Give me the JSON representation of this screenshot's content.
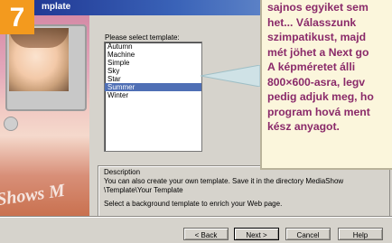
{
  "badge": {
    "number": "7"
  },
  "window": {
    "title": "mplate"
  },
  "preview": {
    "watermark": "Shows M"
  },
  "templates": {
    "label": "Please select template:",
    "items": [
      "Autumn",
      "Machine",
      "Simple",
      "Sky",
      "Star",
      "Summer",
      "Winter"
    ],
    "selected": "Summer"
  },
  "description": {
    "title": "Description",
    "line1": "You can also create your own template. Save it in the directory MediaShow",
    "line2": "\\Template\\Your Template",
    "hint": "Select a background template to enrich your Web page."
  },
  "buttons": {
    "back": "< Back",
    "next": "Next >",
    "cancel": "Cancel",
    "help": "Help"
  },
  "callout": {
    "lines": [
      "sajnos egyiket sem",
      "het... Válasszunk",
      "szimpatikust, majd",
      "mét jöhet a Next go",
      "A képméretet álli",
      "800×600-asra, legv",
      "pedig adjuk meg, ho",
      "program hová ment",
      "kész anyagot."
    ]
  },
  "colors": {
    "badge": "#f39a1e",
    "callout_text": "#8a2a6a",
    "callout_bg": "#fbf6dc",
    "selection": "#4f6fb5"
  }
}
